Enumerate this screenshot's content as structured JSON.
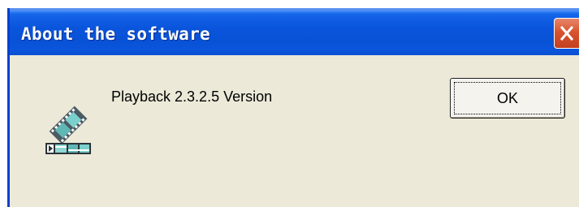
{
  "window": {
    "title": "About the software",
    "close_icon": "close-icon"
  },
  "content": {
    "icon": "video-playback-icon",
    "message": "Playback 2.3.2.5 Version"
  },
  "buttons": {
    "ok_label": "OK"
  },
  "colors": {
    "titlebar": "#0a55dc",
    "dialog_background": "#ece9d8",
    "close_button": "#d8542f"
  }
}
